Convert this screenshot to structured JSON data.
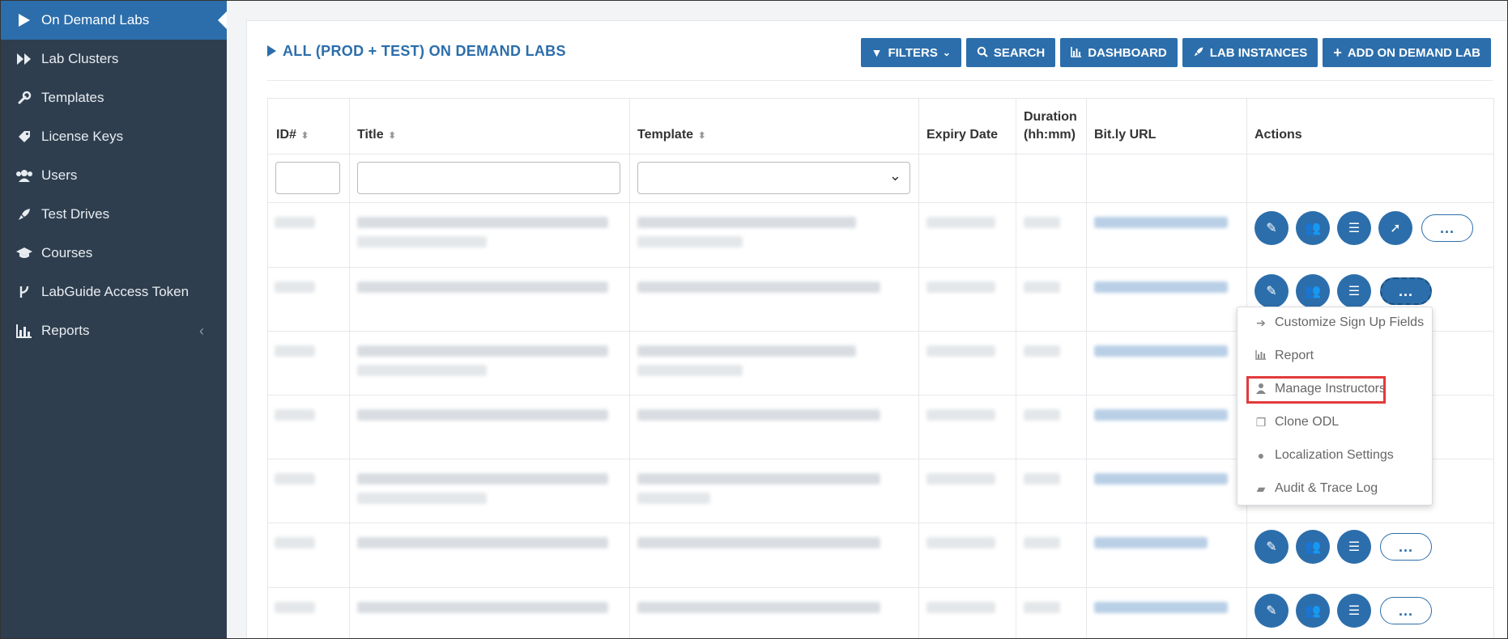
{
  "sidebar": {
    "items": [
      {
        "label": "On Demand Labs",
        "icon": "play-icon"
      },
      {
        "label": "Lab Clusters",
        "icon": "fast-forward-icon"
      },
      {
        "label": "Templates",
        "icon": "wrench-icon"
      },
      {
        "label": "License Keys",
        "icon": "tag-icon"
      },
      {
        "label": "Users",
        "icon": "users-icon"
      },
      {
        "label": "Test Drives",
        "icon": "rocket-icon"
      },
      {
        "label": "Courses",
        "icon": "graduation-cap-icon"
      },
      {
        "label": "LabGuide Access Token",
        "icon": "code-fork-icon"
      },
      {
        "label": "Reports",
        "icon": "bar-chart-icon"
      }
    ]
  },
  "header": {
    "title": "ALL (PROD + TEST) ON DEMAND LABS",
    "buttons": {
      "filters": "FILTERS",
      "search": "SEARCH",
      "dashboard": "DASHBOARD",
      "lab_instances": "LAB INSTANCES",
      "add": "ADD ON DEMAND LAB"
    }
  },
  "table": {
    "columns": {
      "id": "ID#",
      "title": "Title",
      "template": "Template",
      "expiry": "Expiry Date",
      "duration_line1": "Duration",
      "duration_line2": "(hh:mm)",
      "bitly": "Bit.ly URL",
      "actions": "Actions"
    },
    "more_label": "..."
  },
  "menu": {
    "items": [
      {
        "label": "Customize Sign Up Fields",
        "icon": "sign-in-icon"
      },
      {
        "label": "Report",
        "icon": "bar-chart-icon"
      },
      {
        "label": "Manage Instructors",
        "icon": "user-icon"
      },
      {
        "label": "Clone ODL",
        "icon": "clone-icon"
      },
      {
        "label": "Localization Settings",
        "icon": "globe-icon"
      },
      {
        "label": "Audit & Trace Log",
        "icon": "book-icon"
      }
    ]
  },
  "colors": {
    "accent": "#2c6eab",
    "sidebar": "#2f3e4e",
    "highlight": "#e23a3a"
  }
}
